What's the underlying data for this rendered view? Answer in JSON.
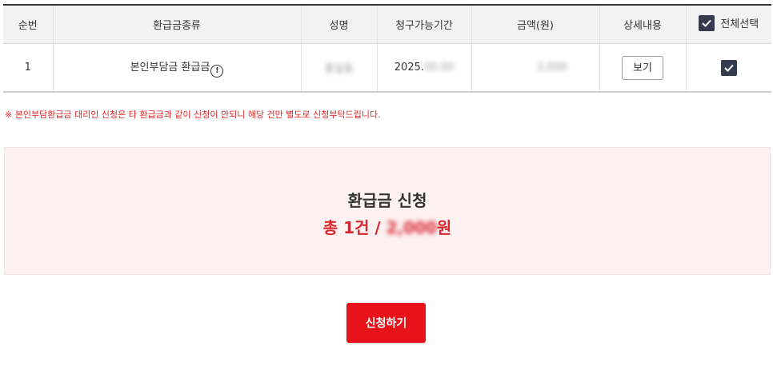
{
  "table": {
    "headers": {
      "no": "순번",
      "type": "환급금종류",
      "name": "성명",
      "period": "청구가능기간",
      "amount": "금액(원)",
      "detail": "상세내용",
      "select_all": "전체선택"
    },
    "rows": [
      {
        "no": "1",
        "type": "본인부담금 환급금",
        "name": "홍길동",
        "period_prefix": "2025.",
        "period_hidden": "00.00",
        "amount": "2,000",
        "detail_button": "보기",
        "checked": true
      }
    ]
  },
  "notice": "※ 본인부담환급금 대리인 신청은 타 환급금과 같이 신청이 안되니 해당 건만 별도로 신청부탁드립니다.",
  "summary": {
    "title": "환급금 신청",
    "total_prefix": "총 1건 / ",
    "total_amount": "2,000",
    "total_suffix": "원"
  },
  "apply_button": "신청하기",
  "colors": {
    "accent_red": "#e8131a",
    "checkbox": "#353b4f",
    "summary_bg": "#fdf1f2"
  }
}
